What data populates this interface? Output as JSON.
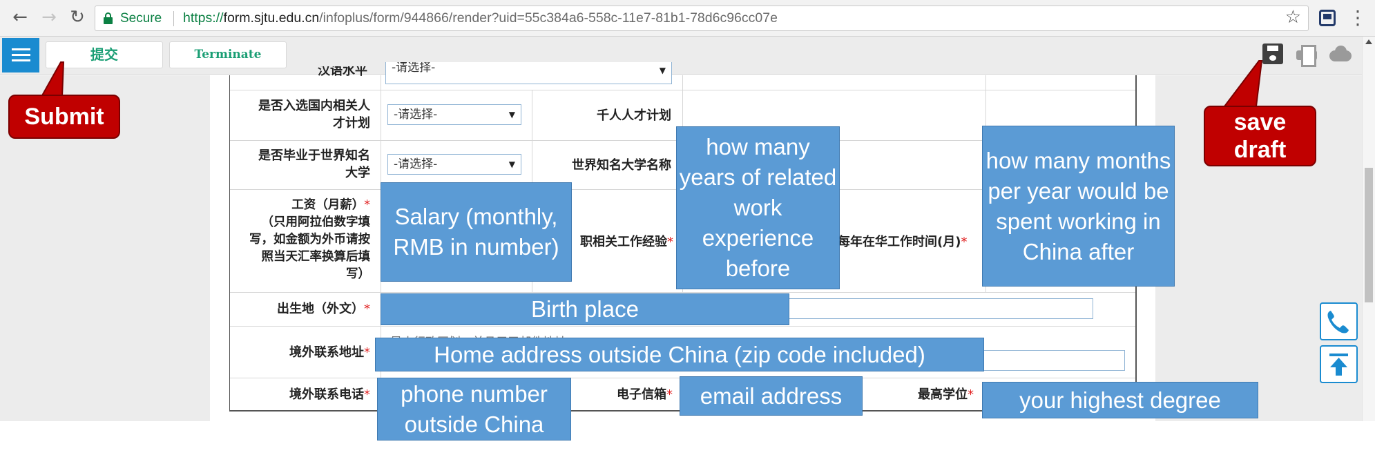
{
  "browser": {
    "secure_label": "Secure",
    "url_scheme": "https://",
    "url_host": "form.sjtu.edu.cn",
    "url_path": "/infoplus/form/944866/render?uid=55c384a6-558c-11e7-81b1-78d6c96cc07e",
    "icons": [
      "back-arrow-icon",
      "forward-arrow-icon",
      "reload-icon",
      "lock-icon",
      "star-icon",
      "extension-icon",
      "kebab-menu-icon"
    ]
  },
  "toolbar": {
    "submit_label": "提交",
    "terminate_label": "Terminate",
    "icons": [
      "menu-icon",
      "save-icon",
      "print-icon",
      "cloud-download-icon"
    ]
  },
  "form": {
    "select_placeholder": "-请选择-",
    "rows": {
      "chinese_level": {
        "label": "汉语水平"
      },
      "talent_program": {
        "label": "是否入选国内相关人才计划",
        "label_lines": [
          "是否入选国内相关人",
          "才计划"
        ],
        "right_label": "千人人才计划"
      },
      "famous_univ": {
        "label_lines": [
          "是否毕业于世界知名",
          "大学"
        ],
        "right_label": "世界知名大学名称"
      },
      "salary": {
        "label_lines": [
          "工资（月薪）",
          "（只用阿拉伯数字填",
          "写，如金额为外币请按",
          "照当天汇率换算后填",
          "写）"
        ],
        "mid_label": "职相关工作经验",
        "right_label": "每年在华工作时间(月)"
      },
      "birthplace": {
        "label": "出生地（外文）"
      },
      "address": {
        "label": "境外联系地址",
        "hint": "最小行政区划，并且用于邮件地址"
      },
      "contact": {
        "label": "境外联系电话",
        "mid_label": "电子信箱",
        "right_label": "最高学位"
      }
    },
    "required_mark": "*"
  },
  "annotations": {
    "submit_callout": "Submit",
    "save_callout": "save draft",
    "salary_note": "Salary (monthly, RMB in number)",
    "experience_note": "how many years of related work experience before",
    "months_note": "how many months per year would be spent working in China after",
    "birthplace_note": "Birth place",
    "address_note": "Home address outside China (zip code included)",
    "phone_note": "phone number outside China",
    "email_note": "email address",
    "degree_note": "your highest degree"
  },
  "floating": {
    "icons": [
      "phone-icon",
      "back-to-top-icon"
    ]
  },
  "colors": {
    "annotation_blue": "#5b9bd5",
    "callout_red": "#c00000",
    "toolbar_blue": "#1a8bd0",
    "secure_green": "#0b8043",
    "button_text_green": "#1a9e74",
    "required_red": "#e02020"
  }
}
